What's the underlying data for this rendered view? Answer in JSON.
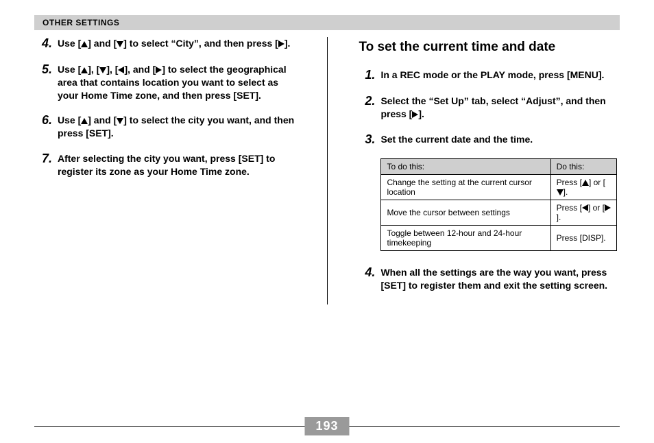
{
  "header": "OTHER SETTINGS",
  "page_number": "193",
  "left": {
    "steps": [
      {
        "n": "4.",
        "html": "Use [UP] and [DOWN] to select “City”, and then press [RIGHT]."
      },
      {
        "n": "5.",
        "html": "Use [UP], [DOWN], [LEFT], and [RIGHT] to select the geographical area that contains location you want to select as your Home Time zone, and then press [SET]."
      },
      {
        "n": "6.",
        "html": "Use [UP] and [DOWN] to select the city you want, and then press [SET]."
      },
      {
        "n": "7.",
        "html": "After selecting the city you want, press [SET] to register its zone as your Home Time zone."
      }
    ]
  },
  "right": {
    "title": "To set the current time and date",
    "steps_top": [
      {
        "n": "1.",
        "html": "In a REC mode or the PLAY mode, press [MENU]."
      },
      {
        "n": "2.",
        "html": "Select the “Set Up” tab, select “Adjust”, and then press [RIGHT]."
      },
      {
        "n": "3.",
        "html": "Set the current date and the time."
      }
    ],
    "table": {
      "head": [
        "To do this:",
        "Do this:"
      ],
      "rows": [
        [
          "Change the setting at the current cursor location",
          "Press [UP] or [DOWN]."
        ],
        [
          "Move the cursor between settings",
          "Press [LEFT] or [RIGHT]."
        ],
        [
          "Toggle between 12-hour and 24-hour timekeeping",
          "Press [DISP]."
        ]
      ]
    },
    "steps_bottom": [
      {
        "n": "4.",
        "html": "When all the settings are the way you want, press [SET] to register them and exit the setting screen."
      }
    ]
  }
}
